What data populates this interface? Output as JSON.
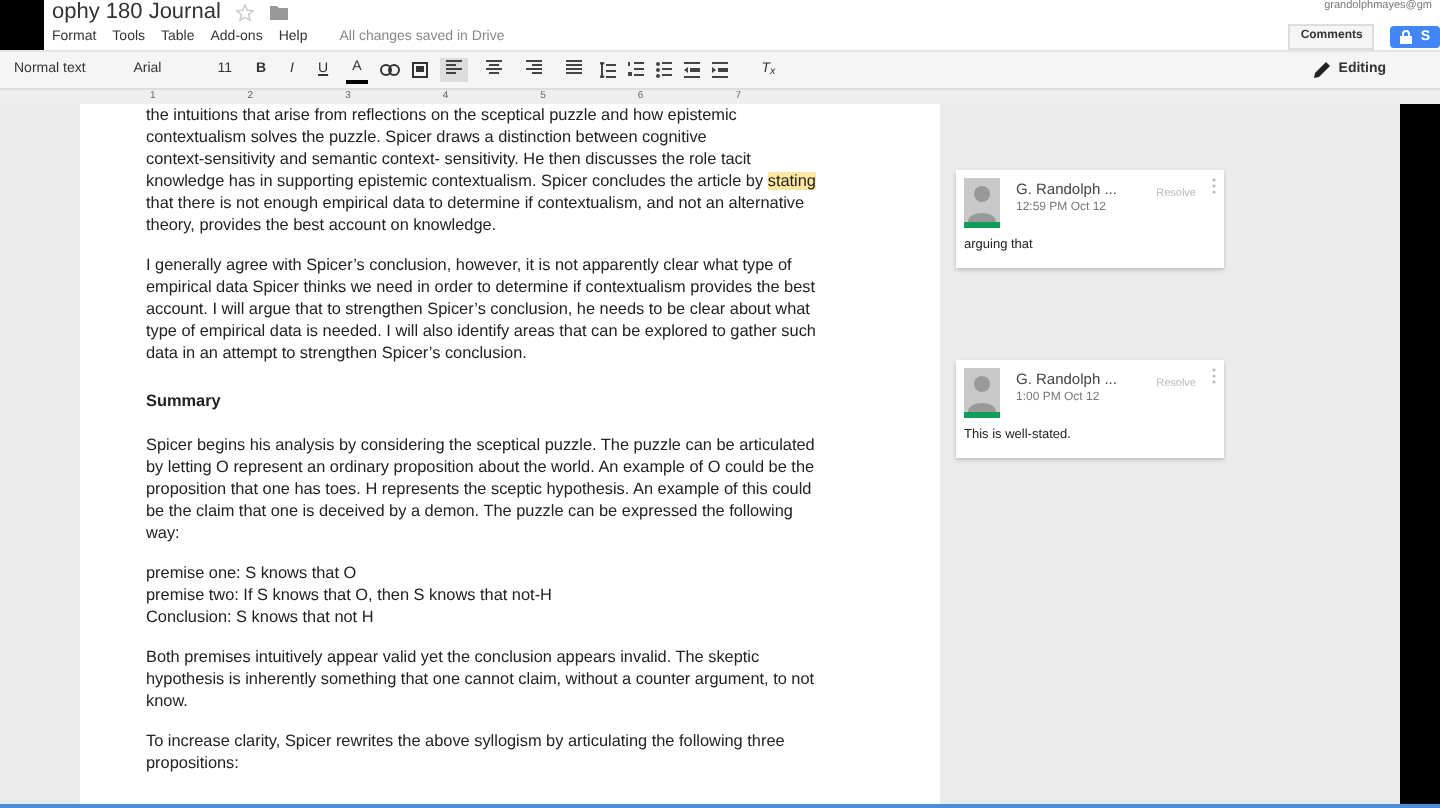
{
  "header": {
    "title": "ophy 180 Journal",
    "starred": false,
    "account": "grandolphmayes@gm",
    "comments_button": "Comments",
    "share_button": "S"
  },
  "menu": {
    "items": [
      "Format",
      "Tools",
      "Table",
      "Add-ons",
      "Help"
    ],
    "status": "All changes saved in Drive"
  },
  "toolbar": {
    "style": "Normal text",
    "font": "Arial",
    "size": "11",
    "bold": "B",
    "italic": "I",
    "underline": "U",
    "text_color_label": "A",
    "clear_format": "T$_{x}$",
    "mode": "Editing",
    "align": [
      {
        "kind": "left",
        "selected": true
      },
      {
        "kind": "center",
        "selected": false
      },
      {
        "kind": "right",
        "selected": false
      },
      {
        "kind": "justify",
        "selected": false
      }
    ]
  },
  "ruler": [
    "1",
    "2",
    "3",
    "4",
    "5",
    "6",
    "7"
  ],
  "document": [
    {
      "kind": "para",
      "lines": [
        [
          {
            "text": "the intuitions that arise from reflections on the sceptical puzzle and how epistemic",
            "highlighted": false
          }
        ],
        [
          {
            "text": "contextualism solves the puzzle. Spicer draws a distinction between cognitive",
            "highlighted": false
          }
        ],
        [
          {
            "text": "context-sensitivity and semantic context- sensitivity. He then discusses the role tacit",
            "highlighted": false
          }
        ],
        [
          {
            "text": "knowledge has in supporting epistemic contextualism. Spicer concludes the article by ",
            "highlighted": false
          },
          {
            "text": "stating",
            "highlighted": true
          }
        ],
        [
          {
            "text": "that there is not enough empirical data to determine if  contextualism, and not an alternative",
            "highlighted": false
          }
        ],
        [
          {
            "text": "theory, provides the best account on knowledge.",
            "highlighted": false
          }
        ]
      ]
    },
    {
      "kind": "para",
      "lines": [
        [
          {
            "text": "I generally agree with Spicer’s conclusion, however, it is not apparently clear what type of",
            "highlighted": false
          }
        ],
        [
          {
            "text": "empirical data Spicer thinks we need in order to determine if contextualism provides the best",
            "highlighted": false
          }
        ],
        [
          {
            "text": "account. I will argue that to strengthen Spicer’s conclusion, he needs to be clear about what",
            "highlighted": false
          }
        ],
        [
          {
            "text": "type of empirical data is needed. I will also identify areas that can be explored to gather such",
            "highlighted": false
          }
        ],
        [
          {
            "text": "data in an attempt to strengthen Spicer’s conclusion.",
            "highlighted": false
          }
        ]
      ]
    },
    {
      "kind": "heading",
      "lines": [
        [
          {
            "text": "Summary",
            "highlighted": false
          }
        ]
      ]
    },
    {
      "kind": "para",
      "lines": [
        [
          {
            "text": "Spicer begins his analysis by considering  the sceptical puzzle. The puzzle can be articulated",
            "highlighted": false
          }
        ],
        [
          {
            "text": "by letting O represent an ordinary proposition about the world. An example of O could be the",
            "highlighted": false
          }
        ],
        [
          {
            "text": "proposition that one has toes. H represents the sceptic hypothesis. An example of this could",
            "highlighted": false
          }
        ],
        [
          {
            "text": "be the claim that one is deceived by a demon. The puzzle can be expressed the following",
            "highlighted": false
          }
        ],
        [
          {
            "text": "way:",
            "highlighted": false
          }
        ]
      ]
    },
    {
      "kind": "para",
      "lines": [
        [
          {
            "text": "premise one: S knows that O",
            "highlighted": false
          }
        ],
        [
          {
            "text": "premise two:  If S knows that O, then S knows that not-H",
            "highlighted": false
          }
        ],
        [
          {
            "text": "Conclusion: S knows that not H",
            "highlighted": false
          }
        ]
      ]
    },
    {
      "kind": "para",
      "lines": [
        [
          {
            "text": "Both premises intuitively appear valid yet the conclusion appears invalid. The skeptic",
            "highlighted": false
          }
        ],
        [
          {
            "text": "hypothesis is inherently something that one cannot claim, without a counter argument, to not",
            "highlighted": false
          }
        ],
        [
          {
            "text": "know.",
            "highlighted": false
          }
        ]
      ]
    },
    {
      "kind": "para",
      "lines": [
        [
          {
            "text": "To increase clarity, Spicer rewrites the above syllogism by articulating the following three",
            "highlighted": false
          }
        ],
        [
          {
            "text": "propositions:",
            "highlighted": false
          }
        ]
      ]
    }
  ],
  "comments": [
    {
      "author": "G. Randolph ...",
      "time": "12:59 PM Oct 12",
      "resolve": "Resolve",
      "body": "arguing that"
    },
    {
      "author": "G. Randolph ...",
      "time": "1:00 PM Oct 12",
      "resolve": "Resolve",
      "body": "This is well-stated."
    }
  ]
}
